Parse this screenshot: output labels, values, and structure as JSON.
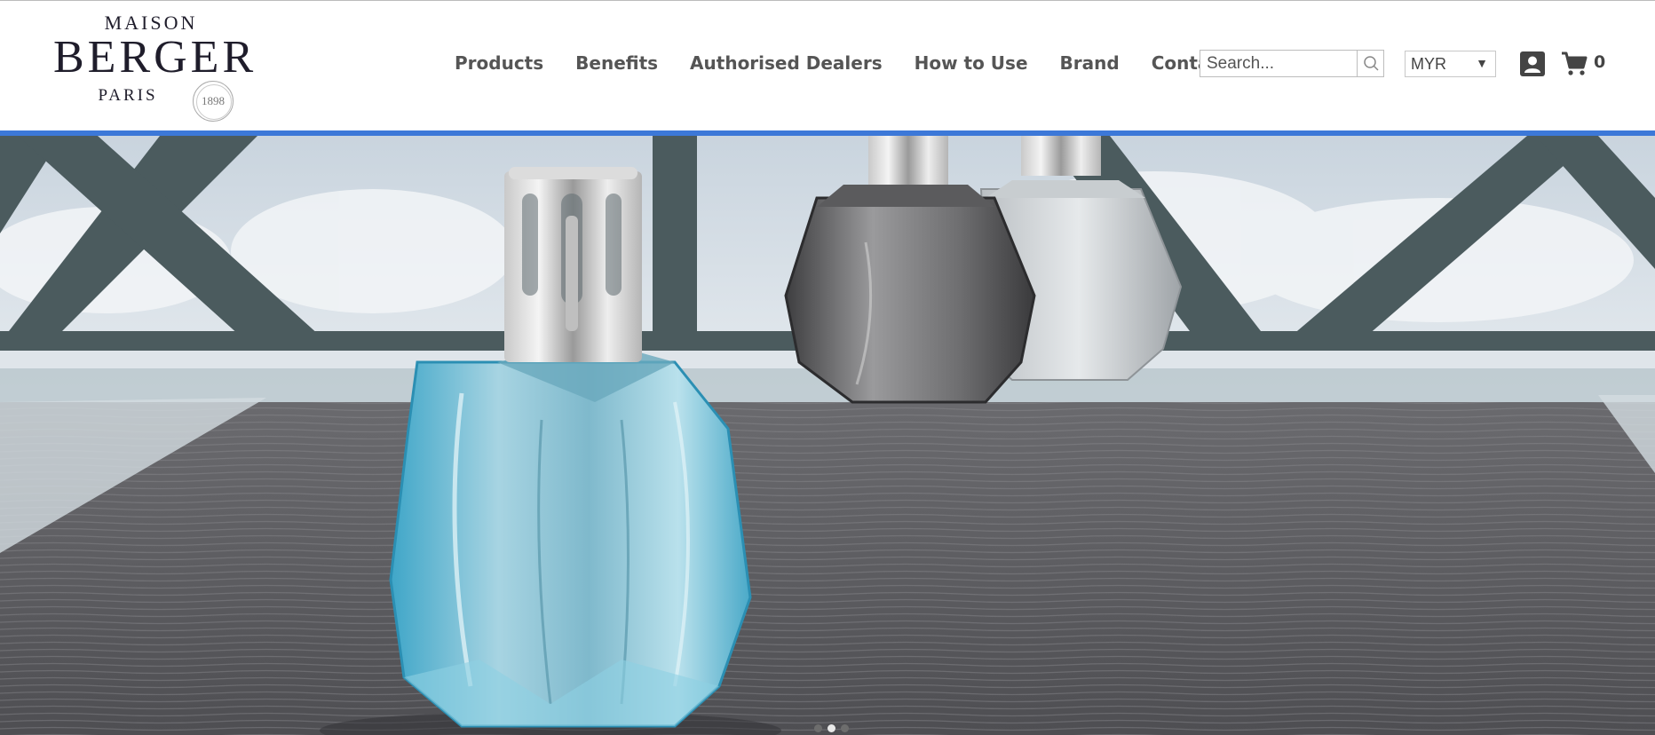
{
  "brand": {
    "line1": "MAISON",
    "line2": "BERGER",
    "line3": "PARIS",
    "seal_year": "1898"
  },
  "nav": {
    "items": [
      {
        "label": "Products"
      },
      {
        "label": "Benefits"
      },
      {
        "label": "Authorised Dealers"
      },
      {
        "label": "How to Use"
      },
      {
        "label": "Brand"
      },
      {
        "label": "Contact us"
      }
    ]
  },
  "search": {
    "placeholder": "Search...",
    "value": "",
    "icon": "search-icon"
  },
  "currency": {
    "selected": "MYR",
    "icon": "caret-down-icon"
  },
  "account": {
    "icon": "account-icon"
  },
  "cart": {
    "icon": "cart-icon",
    "count": "0"
  },
  "colors": {
    "accent": "#3c78d8",
    "nav_text": "#555555",
    "logo": "#1f1d2b"
  },
  "carousel": {
    "slide_count": 3,
    "active_index": 1
  }
}
